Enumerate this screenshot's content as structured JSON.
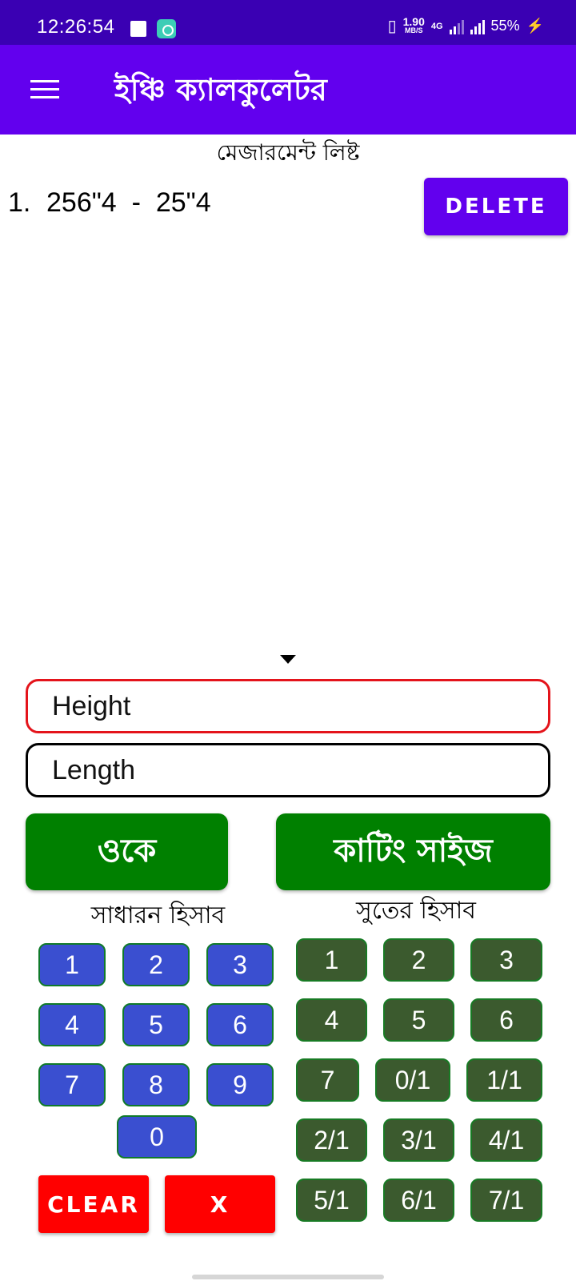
{
  "status_bar": {
    "time": "12:26:54",
    "speed_value": "1.90",
    "speed_unit": "MB/S",
    "network": "4G",
    "battery": "55%",
    "background_color": "#3a00b3",
    "icons": [
      "notification-square-icon",
      "app-notification-icon",
      "vibrate-icon",
      "signal-icon",
      "battery-charging-icon"
    ]
  },
  "app_bar": {
    "title": "ইঞ্চি ক্যালকুলেটর",
    "color": "#6200ee",
    "menu_icon": "hamburger-menu-icon"
  },
  "measurement_list": {
    "heading": "মেজারমেন্ট লিষ্ট",
    "items": [
      {
        "index": "1.",
        "value": "256\"4  -  25\"4",
        "delete_label": "DELETE"
      }
    ]
  },
  "inputs": {
    "height_placeholder": "Height",
    "length_placeholder": "Length"
  },
  "actions": {
    "ok_label": "ওকে",
    "cutting_size_label": "কাটিং সাইজ",
    "color": "#008000"
  },
  "general_keypad": {
    "label": "সাধারন হিসাব",
    "keys": [
      "1",
      "2",
      "3",
      "4",
      "5",
      "6",
      "7",
      "8",
      "9",
      "0"
    ],
    "color": "#3a4fd0"
  },
  "sut_keypad": {
    "label": "সুতের হিসাব",
    "keys": [
      "1",
      "2",
      "3",
      "4",
      "5",
      "6",
      "7",
      "0/1",
      "1/1",
      "2/1",
      "3/1",
      "4/1",
      "5/1",
      "6/1",
      "7/1"
    ],
    "color": "#3b5a2e"
  },
  "controls": {
    "clear_label": "CLEAR",
    "x_label": "X",
    "color": "#ff0000"
  }
}
